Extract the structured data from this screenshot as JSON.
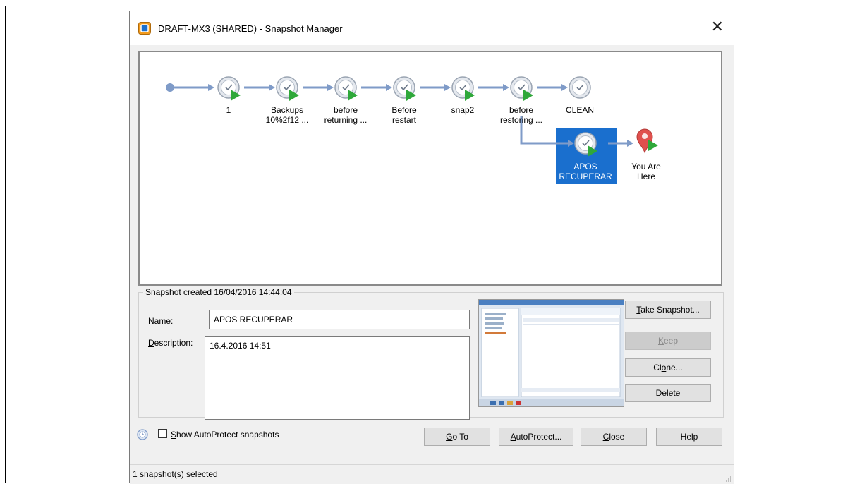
{
  "window": {
    "title": "DRAFT-MX3 (SHARED) - Snapshot Manager",
    "close_icon": "close-icon"
  },
  "tree": {
    "nodes": [
      {
        "label_lines": [
          "1"
        ]
      },
      {
        "label_lines": [
          "Backups",
          "10%2f12 ..."
        ]
      },
      {
        "label_lines": [
          "before",
          "returning ..."
        ]
      },
      {
        "label_lines": [
          "Before",
          "restart"
        ]
      },
      {
        "label_lines": [
          "snap2"
        ]
      },
      {
        "label_lines": [
          "before",
          "restoring ..."
        ]
      },
      {
        "label_lines": [
          "CLEAN"
        ]
      }
    ],
    "selected": {
      "label_lines": [
        "APOS",
        "RECUPERAR"
      ]
    },
    "current": {
      "label_lines": [
        "You Are",
        "Here"
      ]
    },
    "colors": {
      "arrow": "#7f9bc8",
      "selected_bg": "#1a6fce",
      "pin": "#e0504d",
      "play": "#2fa83a"
    }
  },
  "details": {
    "group_title": "Snapshot created 16/04/2016 14:44:04",
    "name_label": "Name:",
    "name_value": "APOS RECUPERAR",
    "description_label": "Description:",
    "description_value": "16.4.2016 14:51"
  },
  "actions": {
    "take_snapshot": "Take Snapshot...",
    "keep": "Keep",
    "clone": "Clone...",
    "delete": "Delete"
  },
  "bottom": {
    "show_autoprotect": "Show AutoProtect snapshots",
    "go_to": "Go To",
    "autoprotect": "AutoProtect...",
    "close": "Close",
    "help": "Help"
  },
  "status": {
    "text": "1 snapshot(s) selected"
  }
}
